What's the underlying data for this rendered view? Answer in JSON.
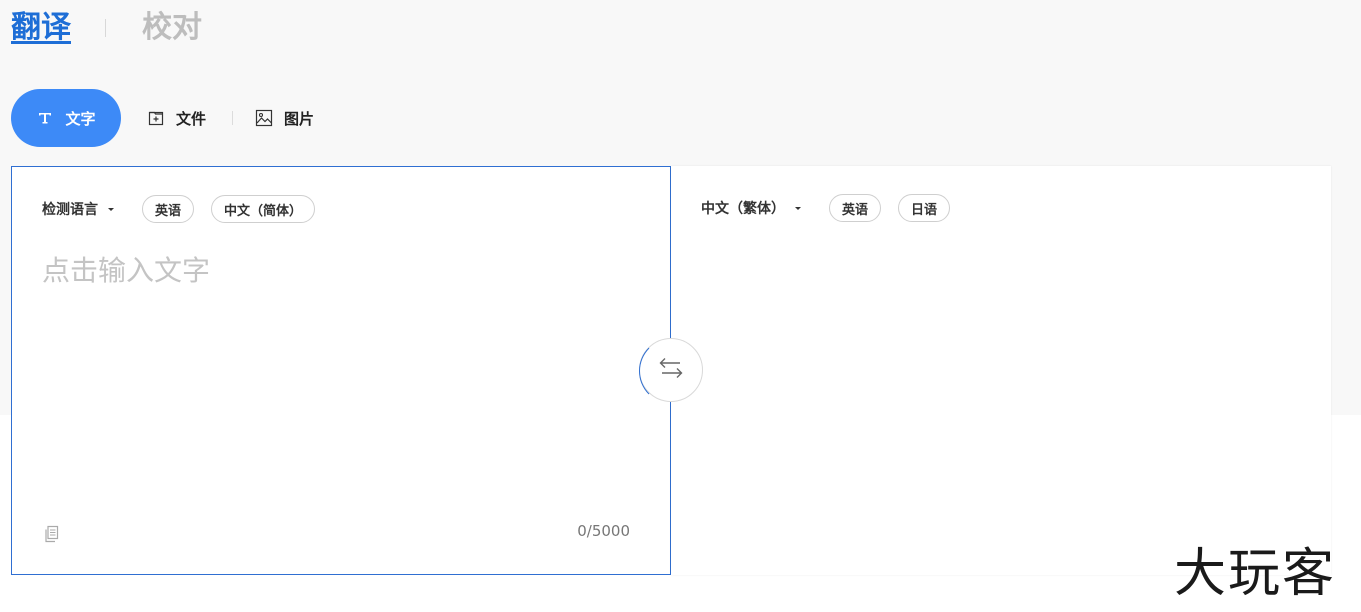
{
  "mode_tabs": {
    "translate": "翻译",
    "proofread": "校对"
  },
  "input_types": {
    "text": "文字",
    "file": "文件",
    "image": "图片"
  },
  "source": {
    "lang_select": "检测语言",
    "chips": [
      "英语",
      "中文（简体）"
    ],
    "placeholder": "点击输入文字",
    "char_count": "0/5000"
  },
  "target": {
    "lang_select": "中文（繁体）",
    "chips": [
      "英语",
      "日语"
    ]
  },
  "watermark": "大玩客",
  "colors": {
    "accent": "#3d8af7",
    "active_tab": "#1e6ed6",
    "panel_border": "#2f6fd2"
  },
  "icons": {
    "text": "text-icon",
    "file": "file-add-icon",
    "image": "image-icon",
    "swap": "swap-arrows-icon",
    "copy": "copy-icon"
  }
}
